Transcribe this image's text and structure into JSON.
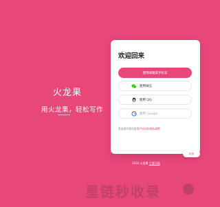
{
  "colors": {
    "brand": "#e8477a",
    "card": "#ffffff"
  },
  "brand": {
    "title": "火龙果",
    "tagline": "用火龙果，轻松写作"
  },
  "login": {
    "title": "欢迎回来",
    "primary_button": "使用邮箱或手机号",
    "wechat_button": "使用微信",
    "qq_button": "使用 QQ",
    "google_button": "使用 Google",
    "agreement_prefix": "登录即代表同意",
    "agreement_terms": "用户协议",
    "agreement_and": "和",
    "agreement_privacy": "隐私政策"
  },
  "footer": {
    "copyright": "2024 火龙果",
    "link": "主要功能"
  },
  "feedback": "反馈",
  "watermark": "星链秒收录",
  "icons": [
    "wechat-icon",
    "qq-icon",
    "google-icon"
  ]
}
